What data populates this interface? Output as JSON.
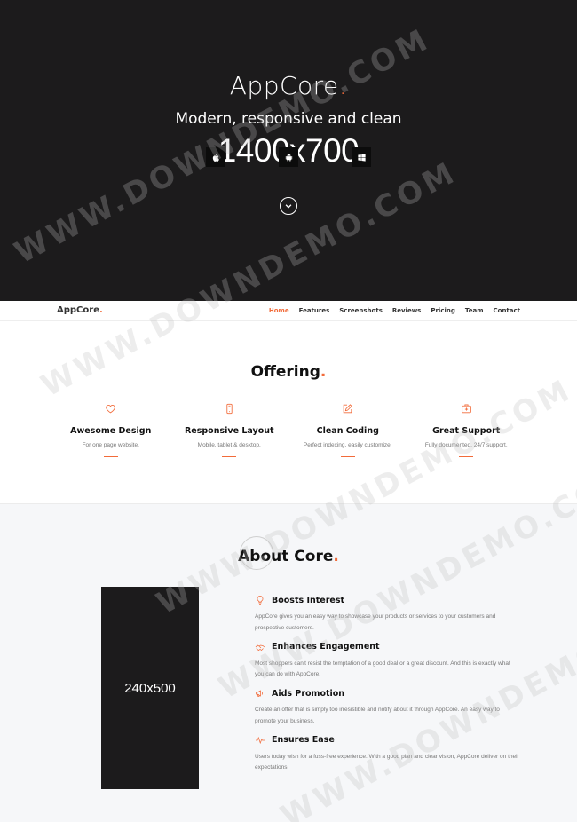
{
  "hero": {
    "brand": "AppCore",
    "brand_dot": ".",
    "subtitle": "Modern, responsive and clean",
    "image_placeholder": "1400x700",
    "store_icons": [
      "apple-icon",
      "android-icon",
      "windows-icon"
    ],
    "scroll_icon": "chevron-down-icon"
  },
  "nav": {
    "logo": "AppCore",
    "logo_dot": ".",
    "links": [
      {
        "label": "Home",
        "active": true
      },
      {
        "label": "Features"
      },
      {
        "label": "Screenshots"
      },
      {
        "label": "Reviews"
      },
      {
        "label": "Pricing"
      },
      {
        "label": "Team"
      },
      {
        "label": "Contact"
      }
    ]
  },
  "offering": {
    "title": "Offering",
    "title_dot": ".",
    "items": [
      {
        "icon": "heart-icon",
        "title": "Awesome Design",
        "text": "For one page website."
      },
      {
        "icon": "mobile-icon",
        "title": "Responsive Layout",
        "text": "Mobile, tablet & desktop."
      },
      {
        "icon": "edit-icon",
        "title": "Clean Coding",
        "text": "Perfect indexing, easily customize."
      },
      {
        "icon": "first-aid-icon",
        "title": "Great Support",
        "text": "Fully documented, 24/7 support."
      }
    ]
  },
  "about": {
    "title": "About Core",
    "title_dot": ".",
    "image_placeholder": "240x500",
    "items": [
      {
        "icon": "bulb-icon",
        "title": "Boosts Interest",
        "text": "AppCore gives you an easy way to showcase your products or services to your customers and prospective customers."
      },
      {
        "icon": "handshake-icon",
        "title": "Enhances Engagement",
        "text": "Most shoppers can't resist the temptation of a good deal or a great discount. And this is exactly what you can do with AppCore."
      },
      {
        "icon": "megaphone-icon",
        "title": "Aids Promotion",
        "text": "Create an offer that is simply too irresistible and notify about it through AppCore. An easy way to promote your business."
      },
      {
        "icon": "pulse-icon",
        "title": "Ensures Ease",
        "text": "Users today wish for a fuss-free experience. With a good plan and clear vision, AppCore deliver on their expectations."
      }
    ]
  },
  "watermark": "WWW.DOWNDEMO.COM",
  "colors": {
    "accent": "#f26b3a",
    "dark": "#1c1b1c"
  }
}
